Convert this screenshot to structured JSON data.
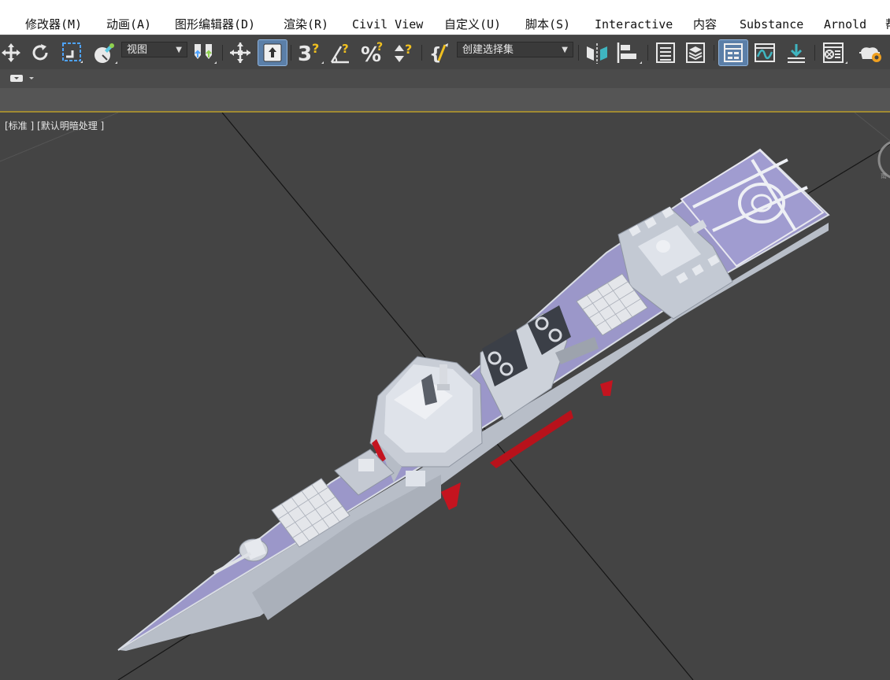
{
  "menu": {
    "items": [
      "修改器(M)",
      "动画(A)",
      "图形编辑器(D)",
      "渲染(R)",
      "Civil View",
      "自定义(U)",
      "脚本(S)",
      "Interactive",
      "内容",
      "Substance",
      "Arnold"
    ]
  },
  "toolbar": {
    "view_dropdown": "视图",
    "selection_set_dropdown": "创建选择集",
    "snap_number": "3"
  },
  "viewport": {
    "label_view": "[标准 ]",
    "label_shading": "[默认明暗处理 ]"
  },
  "colors": {
    "menubar_bg": "#ffffff",
    "toolbar_bg": "#444444",
    "viewport_bg": "#444444",
    "deck": "#9b97c9",
    "hull": "#c9cfd8",
    "waterline": "#c4141f",
    "accent_active": "#5b7fa8",
    "viewport_border": "#a08a32"
  },
  "icons": [
    "move-icon",
    "rotate-icon",
    "scale-icon",
    "select-object-icon",
    "selection-filter-icon",
    "pivot-icon",
    "select-and-place-icon",
    "snap-toggle-icon",
    "angle-snap-icon",
    "percent-snap-icon",
    "spinner-snap-icon",
    "edit-named-selection-icon",
    "mirror-icon",
    "align-icon",
    "scene-explorer-icon",
    "layer-explorer-icon",
    "ribbon-toggle-icon",
    "curve-editor-icon",
    "schematic-view-icon",
    "material-editor-icon",
    "render-setup-icon"
  ]
}
